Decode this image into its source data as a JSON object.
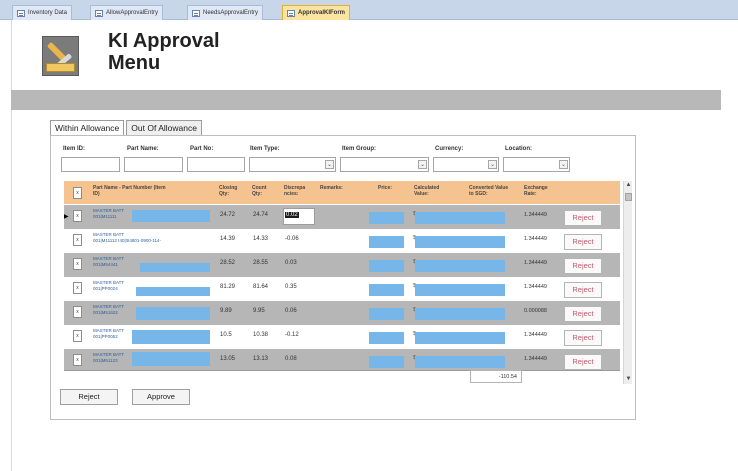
{
  "doc_tabs": [
    {
      "label": "Inventory Data",
      "active": false
    },
    {
      "label": "AllowApprovalEntry",
      "active": false
    },
    {
      "label": "NeedsApprovalEntry",
      "active": false
    },
    {
      "label": "ApprovalKIForm",
      "active": true
    }
  ],
  "header": {
    "title_line1": "KI Approval",
    "title_line2": "Menu",
    "icon": "tools-icon"
  },
  "tabs": [
    {
      "label": "Within Allowance",
      "active": true
    },
    {
      "label": "Out Of Allowance",
      "active": false
    }
  ],
  "filters": {
    "item_id_label": "Item ID:",
    "part_name_label": "Part Name:",
    "part_no_label": "Part No:",
    "item_type_label": "Item Type:",
    "item_group_label": "Item Group:",
    "currency_label": "Currency:",
    "location_label": "Location:"
  },
  "grid": {
    "columns": {
      "part_name": "Part Name - Part Number (Item ID)",
      "closing_qty": "Closing Qty:",
      "count_qty": "Count Qty:",
      "discrepancies": "Discrepa ncies:",
      "remarks": "Remarks:",
      "price": "Price:",
      "calculated_value": "Calculated Value:",
      "converted_value": "Converted Value to SGD:",
      "exchange_rate": "Exchange Rate:"
    },
    "rows": [
      {
        "name": "MASTER BATT",
        "code": "001|M11111",
        "closing": "24.72",
        "count": "24.74",
        "disc": "0.02",
        "rate": "1.344449",
        "reject": "Reject",
        "current": true
      },
      {
        "name": "MASTER BATT",
        "code": "001|M11112 I40|3I4801-0900-114-",
        "closing": "14.39",
        "count": "14.33",
        "disc": "-0.06",
        "rate": "1.344449",
        "reject": "Reject",
        "current": false
      },
      {
        "name": "MASTER BATT",
        "code": "001|M54441",
        "closing": "28.52",
        "count": "28.55",
        "disc": "0.03",
        "rate": "1.344449",
        "reject": "Reject",
        "current": false
      },
      {
        "name": "MASTER BATT",
        "code": "001|PP0024",
        "closing": "81.29",
        "count": "81.64",
        "disc": "0.35",
        "rate": "1.344449",
        "reject": "Reject",
        "current": false
      },
      {
        "name": "MASTER BATT",
        "code": "001|M51622",
        "closing": "9.89",
        "count": "9.95",
        "disc": "0.06",
        "rate": "0.000088",
        "reject": "Reject",
        "current": false
      },
      {
        "name": "MASTER BATT",
        "code": "001|PP0052",
        "closing": "10.5",
        "count": "10.38",
        "disc": "-0.12",
        "rate": "1.344449",
        "reject": "Reject",
        "current": false
      },
      {
        "name": "MASTER BATT",
        "code": "001|M51123",
        "closing": "13.05",
        "count": "13.13",
        "disc": "0.08",
        "rate": "1.344449",
        "reject": "Reject",
        "current": false
      }
    ],
    "record_selector": "▶",
    "checkbox_mark": "x",
    "calc_prefix": "$",
    "total": "-110.54"
  },
  "buttons": {
    "reject": "Reject",
    "approve": "Approve"
  }
}
